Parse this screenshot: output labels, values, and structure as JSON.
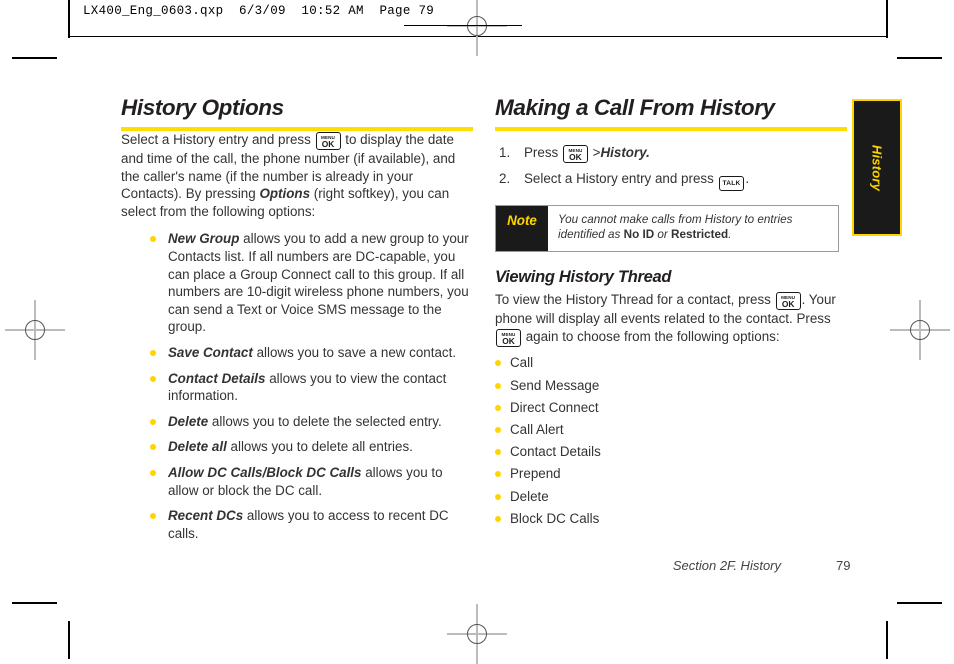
{
  "print_marks": {
    "slug": "LX400_Eng_0603.qxp  6/3/09  10:52 AM  Page 79"
  },
  "left_column": {
    "heading": "History Options",
    "intro": {
      "part1": "Select a History entry and press ",
      "key1": "menu-ok-key",
      "part2": " to display the date and time of the call, the phone number (if available), and the caller's name (if the number is already in your Contacts). By pressing ",
      "emphasis": "Options",
      "part3": " (right softkey), you can select from the following options:"
    },
    "options": [
      {
        "term": "New Group",
        "text": " allows you to add a new group to your Contacts list. If all numbers are DC-capable, you can place a Group Connect call to this group. If all numbers are 10-digit wireless phone numbers, you can send a Text or Voice SMS message to the group."
      },
      {
        "term": "Save Contact",
        "text": " allows you to save a new contact."
      },
      {
        "term": "Contact Details",
        "text": " allows you to view the contact information."
      },
      {
        "term": "Delete",
        "text": " allows you to delete the selected entry."
      },
      {
        "term": "Delete all",
        "text": " allows you to delete all entries."
      },
      {
        "term": "Allow DC Calls/Block DC Calls",
        "text": " allows you to allow or block the DC call."
      },
      {
        "term": "Recent DCs",
        "text": " allows you to access to recent DC calls."
      }
    ]
  },
  "right_column": {
    "heading": "Making a Call From History",
    "steps": [
      {
        "number": "1.",
        "before_key": "Press ",
        "key": "menu-ok-key",
        "after_key": " >",
        "italic_tail": "History."
      },
      {
        "number": "2.",
        "before_key": "Select a History entry and press ",
        "key": "talk-key",
        "after_key": "."
      }
    ],
    "note": {
      "label": "Note",
      "text_part1": "You cannot make calls from History to entries identified as ",
      "bold1": "No ID",
      "text_part2": " or ",
      "bold2": "Restricted",
      "text_part3": "."
    },
    "subheading": "Viewing History Thread",
    "thread_intro": {
      "part1": "To view the History Thread for a contact, press ",
      "key1": "menu-ok-key",
      "part2": ". Your phone will display all events related to the contact. Press ",
      "key2": "menu-ok-key",
      "part3": " again to choose from the following options:"
    },
    "thread_options": [
      "Call",
      "Send Message",
      "Direct Connect",
      "Call Alert",
      "Contact Details",
      "Prepend",
      "Delete",
      "Block DC Calls"
    ]
  },
  "side_tab": {
    "label": "History"
  },
  "footer": {
    "section": "Section 2F. History",
    "page_number": "79"
  },
  "keys": {
    "menu_ok": {
      "top": "MENU",
      "bottom": "OK"
    },
    "talk": {
      "label": "TALK"
    }
  },
  "colors": {
    "accent_yellow": "#ffdd00",
    "bullet_yellow": "#ffd400",
    "note_dark": "#1a1a1a",
    "body_text": "#333333"
  }
}
